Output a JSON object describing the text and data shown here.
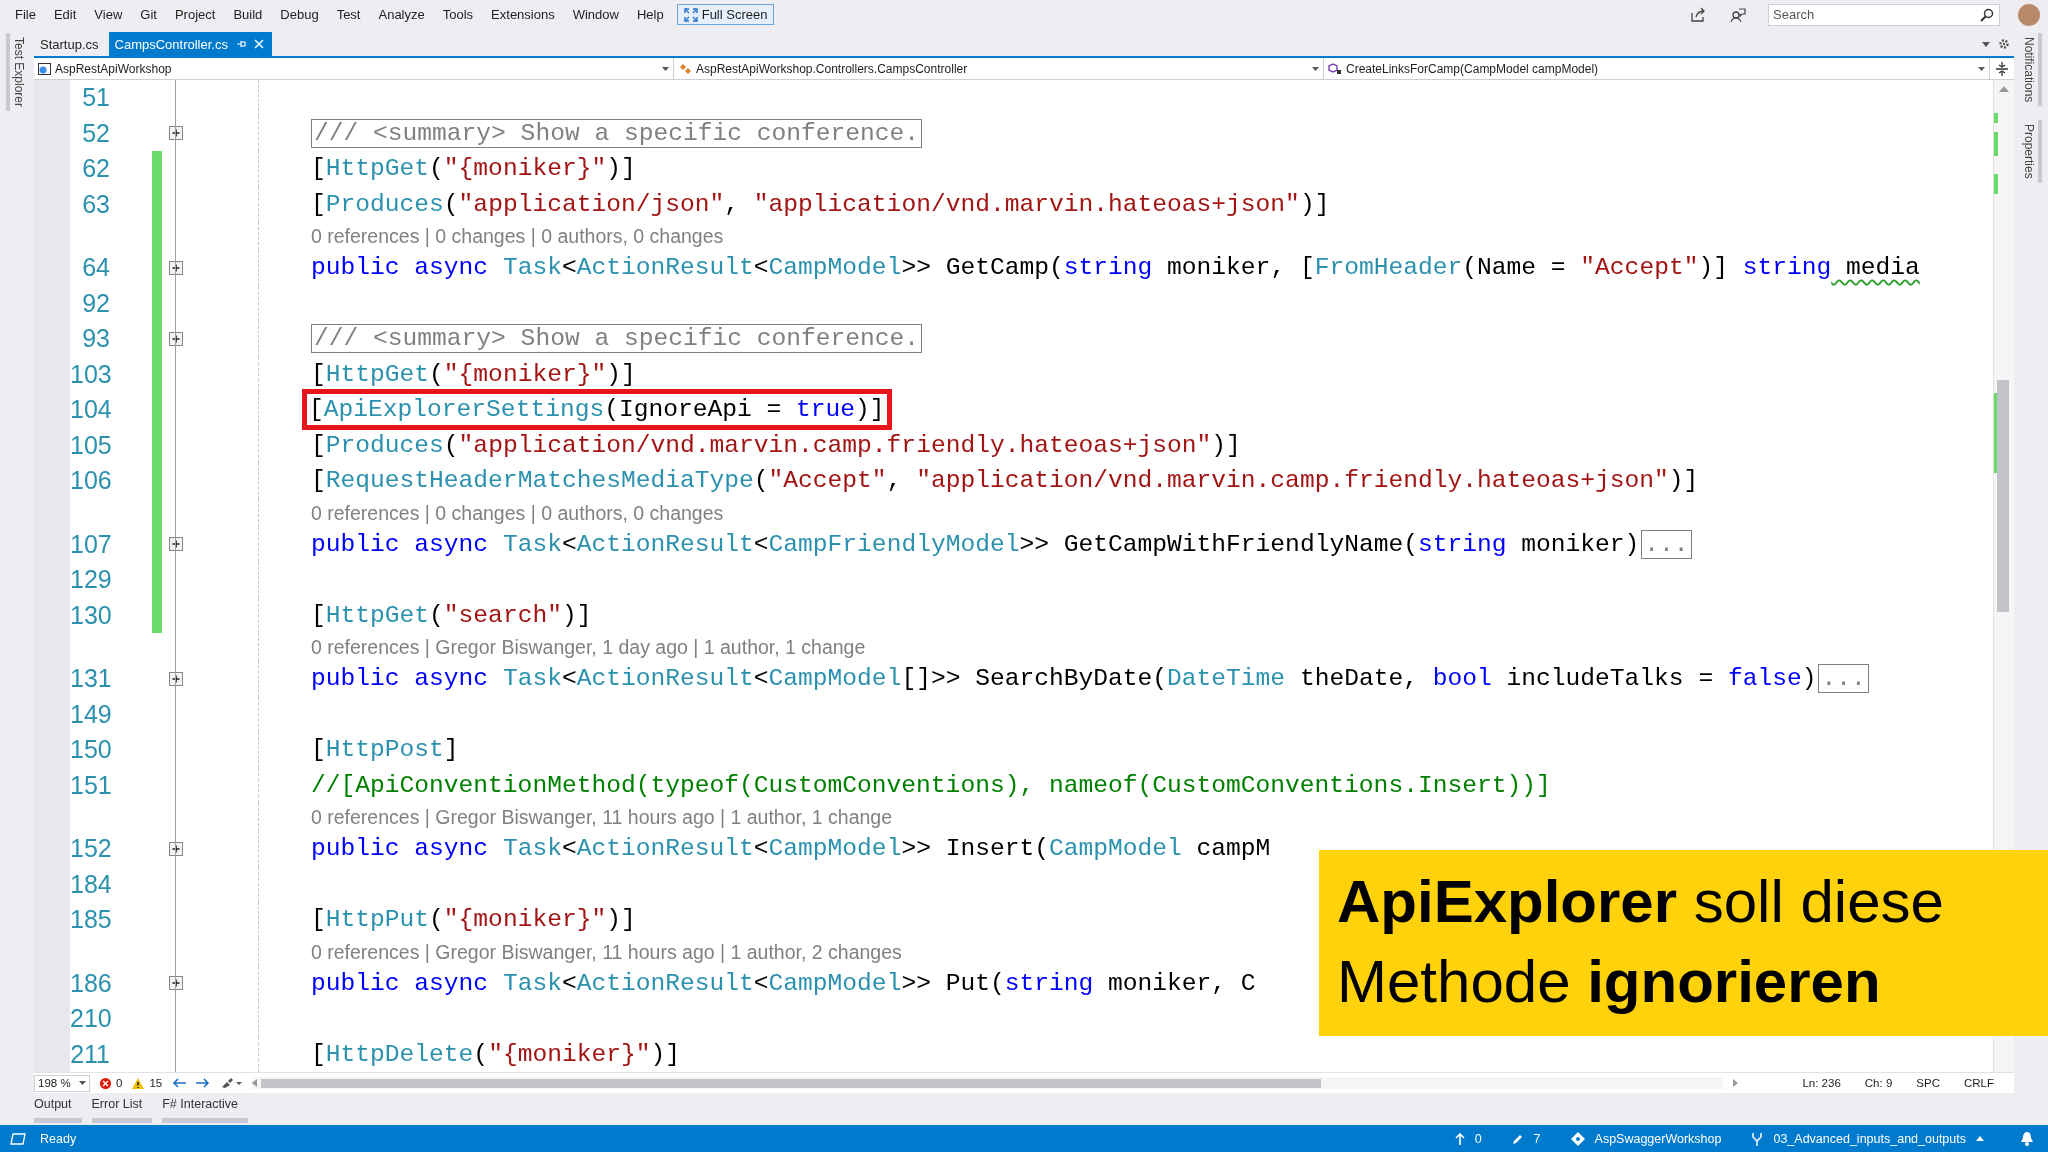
{
  "menu": [
    "File",
    "Edit",
    "View",
    "Git",
    "Project",
    "Build",
    "Debug",
    "Test",
    "Analyze",
    "Tools",
    "Extensions",
    "Window",
    "Help"
  ],
  "full_screen_button": "Full Screen",
  "search": {
    "placeholder": "Search"
  },
  "side_tabs_left": [
    "Test Explorer"
  ],
  "side_tabs_right": [
    "Notifications",
    "Properties"
  ],
  "document_tabs": [
    {
      "label": "Startup.cs",
      "selected": false
    },
    {
      "label": "CampsController.cs",
      "selected": true
    }
  ],
  "navigation": {
    "project": "AspRestApiWorkshop",
    "type": "AspRestApiWorkshop.Controllers.CampsController",
    "member": "CreateLinksForCamp(CampModel campModel)"
  },
  "editor": {
    "lines": [
      {
        "kind": "code",
        "number": "51",
        "changed": false,
        "collapsed": false,
        "highlighted": false
      },
      {
        "kind": "code",
        "number": "52",
        "changed": false,
        "collapsed": true,
        "highlighted": false,
        "tokens": [
          {
            "text": "/// <summary> Show a specific conference.",
            "kind": "summary"
          }
        ]
      },
      {
        "kind": "code",
        "number": "62",
        "changed": true,
        "collapsed": false,
        "highlighted": false,
        "tokens": [
          {
            "text": "[",
            "kind": "plain"
          },
          {
            "text": "HttpGet",
            "kind": "type"
          },
          {
            "text": "(",
            "kind": "plain"
          },
          {
            "text": "\"{moniker}\"",
            "kind": "string"
          },
          {
            "text": ")]",
            "kind": "plain"
          }
        ]
      },
      {
        "kind": "code",
        "number": "63",
        "changed": true,
        "collapsed": false,
        "highlighted": false,
        "tokens": [
          {
            "text": "[",
            "kind": "plain"
          },
          {
            "text": "Produces",
            "kind": "type"
          },
          {
            "text": "(",
            "kind": "plain"
          },
          {
            "text": "\"application/json\"",
            "kind": "string"
          },
          {
            "text": ", ",
            "kind": "plain"
          },
          {
            "text": "\"application/vnd.marvin.hateoas+json\"",
            "kind": "string"
          },
          {
            "text": ")]",
            "kind": "plain"
          }
        ]
      },
      {
        "kind": "lens",
        "text": "0 references | 0 changes | 0 authors, 0 changes",
        "changed": true
      },
      {
        "kind": "code",
        "number": "64",
        "changed": true,
        "collapsed": true,
        "highlighted": false,
        "tokens": [
          {
            "text": "public async ",
            "kind": "keyword"
          },
          {
            "text": "Task",
            "kind": "type"
          },
          {
            "text": "<",
            "kind": "plain"
          },
          {
            "text": "ActionResult",
            "kind": "type"
          },
          {
            "text": "<",
            "kind": "plain"
          },
          {
            "text": "CampModel",
            "kind": "type"
          },
          {
            "text": ">> GetCamp(",
            "kind": "plain"
          },
          {
            "text": "string",
            "kind": "keyword"
          },
          {
            "text": " moniker, [",
            "kind": "plain"
          },
          {
            "text": "FromHeader",
            "kind": "type"
          },
          {
            "text": "(Name = ",
            "kind": "plain"
          },
          {
            "text": "\"Accept\"",
            "kind": "string"
          },
          {
            "text": ")] ",
            "kind": "plain"
          },
          {
            "text": "string",
            "kind": "keyword"
          },
          {
            "text": " media",
            "kind": "plain",
            "warning": true
          }
        ]
      },
      {
        "kind": "code",
        "number": "92",
        "changed": true,
        "collapsed": false,
        "highlighted": false
      },
      {
        "kind": "code",
        "number": "93",
        "changed": true,
        "collapsed": true,
        "highlighted": false,
        "tokens": [
          {
            "text": "/// <summary> Show a specific conference.",
            "kind": "summary"
          }
        ]
      },
      {
        "kind": "code",
        "number": "103",
        "changed": true,
        "collapsed": false,
        "highlighted": false,
        "tokens": [
          {
            "text": "[",
            "kind": "plain"
          },
          {
            "text": "HttpGet",
            "kind": "type"
          },
          {
            "text": "(",
            "kind": "plain"
          },
          {
            "text": "\"{moniker}\"",
            "kind": "string"
          },
          {
            "text": ")]",
            "kind": "plain"
          }
        ]
      },
      {
        "kind": "code",
        "number": "104",
        "changed": true,
        "collapsed": false,
        "highlighted": true,
        "tokens": [
          {
            "text": "[",
            "kind": "plain"
          },
          {
            "text": "ApiExplorerSettings",
            "kind": "type"
          },
          {
            "text": "(IgnoreApi = ",
            "kind": "plain"
          },
          {
            "text": "true",
            "kind": "keyword"
          },
          {
            "text": ")]",
            "kind": "plain"
          }
        ]
      },
      {
        "kind": "code",
        "number": "105",
        "changed": true,
        "collapsed": false,
        "highlighted": false,
        "tokens": [
          {
            "text": "[",
            "kind": "plain"
          },
          {
            "text": "Produces",
            "kind": "type"
          },
          {
            "text": "(",
            "kind": "plain"
          },
          {
            "text": "\"application/vnd.marvin.camp.friendly.hateoas+json\"",
            "kind": "string"
          },
          {
            "text": ")]",
            "kind": "plain"
          }
        ]
      },
      {
        "kind": "code",
        "number": "106",
        "changed": true,
        "collapsed": false,
        "highlighted": false,
        "tokens": [
          {
            "text": "[",
            "kind": "plain"
          },
          {
            "text": "RequestHeaderMatchesMediaType",
            "kind": "type"
          },
          {
            "text": "(",
            "kind": "plain"
          },
          {
            "text": "\"Accept\"",
            "kind": "string"
          },
          {
            "text": ", ",
            "kind": "plain"
          },
          {
            "text": "\"application/vnd.marvin.camp.friendly.hateoas+json\"",
            "kind": "string"
          },
          {
            "text": ")]",
            "kind": "plain"
          }
        ]
      },
      {
        "kind": "lens",
        "text": "0 references | 0 changes | 0 authors, 0 changes",
        "changed": true
      },
      {
        "kind": "code",
        "number": "107",
        "changed": true,
        "collapsed": true,
        "highlighted": false,
        "tokens": [
          {
            "text": "public async ",
            "kind": "keyword"
          },
          {
            "text": "Task",
            "kind": "type"
          },
          {
            "text": "<",
            "kind": "plain"
          },
          {
            "text": "ActionResult",
            "kind": "type"
          },
          {
            "text": "<",
            "kind": "plain"
          },
          {
            "text": "CampFriendlyModel",
            "kind": "type"
          },
          {
            "text": ">> GetCampWithFriendlyName(",
            "kind": "plain"
          },
          {
            "text": "string",
            "kind": "keyword"
          },
          {
            "text": " moniker)",
            "kind": "plain"
          },
          {
            "text": "...",
            "kind": "collapsed"
          }
        ]
      },
      {
        "kind": "code",
        "number": "129",
        "changed": true,
        "collapsed": false,
        "highlighted": false
      },
      {
        "kind": "code",
        "number": "130",
        "changed": true,
        "collapsed": false,
        "highlighted": false,
        "tokens": [
          {
            "text": "[",
            "kind": "plain"
          },
          {
            "text": "HttpGet",
            "kind": "type"
          },
          {
            "text": "(",
            "kind": "plain"
          },
          {
            "text": "\"search\"",
            "kind": "string"
          },
          {
            "text": ")]",
            "kind": "plain"
          }
        ]
      },
      {
        "kind": "lens",
        "text": "0 references | Gregor Biswanger, 1 day ago | 1 author, 1 change",
        "changed": false
      },
      {
        "kind": "code",
        "number": "131",
        "changed": false,
        "collapsed": true,
        "highlighted": false,
        "tokens": [
          {
            "text": "public async ",
            "kind": "keyword"
          },
          {
            "text": "Task",
            "kind": "type"
          },
          {
            "text": "<",
            "kind": "plain"
          },
          {
            "text": "ActionResult",
            "kind": "type"
          },
          {
            "text": "<",
            "kind": "plain"
          },
          {
            "text": "CampModel",
            "kind": "type"
          },
          {
            "text": "[]>> SearchByDate(",
            "kind": "plain"
          },
          {
            "text": "DateTime",
            "kind": "type"
          },
          {
            "text": " theDate, ",
            "kind": "plain"
          },
          {
            "text": "bool",
            "kind": "keyword"
          },
          {
            "text": " includeTalks = ",
            "kind": "plain"
          },
          {
            "text": "false",
            "kind": "keyword"
          },
          {
            "text": ")",
            "kind": "plain"
          },
          {
            "text": "...",
            "kind": "collapsed"
          }
        ]
      },
      {
        "kind": "code",
        "number": "149",
        "changed": false,
        "collapsed": false,
        "highlighted": false
      },
      {
        "kind": "code",
        "number": "150",
        "changed": false,
        "collapsed": false,
        "highlighted": false,
        "tokens": [
          {
            "text": "[",
            "kind": "plain"
          },
          {
            "text": "HttpPost",
            "kind": "type"
          },
          {
            "text": "]",
            "kind": "plain"
          }
        ]
      },
      {
        "kind": "code",
        "number": "151",
        "changed": false,
        "collapsed": false,
        "highlighted": false,
        "tokens": [
          {
            "text": "//[ApiConventionMethod(typeof(CustomConventions), nameof(CustomConventions.Insert))]",
            "kind": "comment"
          }
        ]
      },
      {
        "kind": "lens",
        "text": "0 references | Gregor Biswanger, 11 hours ago | 1 author, 1 change",
        "changed": false
      },
      {
        "kind": "code",
        "number": "152",
        "changed": false,
        "collapsed": true,
        "highlighted": false,
        "tokens": [
          {
            "text": "public async ",
            "kind": "keyword"
          },
          {
            "text": "Task",
            "kind": "type"
          },
          {
            "text": "<",
            "kind": "plain"
          },
          {
            "text": "ActionResult",
            "kind": "type"
          },
          {
            "text": "<",
            "kind": "plain"
          },
          {
            "text": "CampModel",
            "kind": "type"
          },
          {
            "text": ">> Insert(",
            "kind": "plain"
          },
          {
            "text": "CampModel",
            "kind": "type"
          },
          {
            "text": " campM",
            "kind": "plain"
          }
        ]
      },
      {
        "kind": "code",
        "number": "184",
        "changed": false,
        "collapsed": false,
        "highlighted": false
      },
      {
        "kind": "code",
        "number": "185",
        "changed": false,
        "collapsed": false,
        "highlighted": false,
        "tokens": [
          {
            "text": "[",
            "kind": "plain"
          },
          {
            "text": "HttpPut",
            "kind": "type"
          },
          {
            "text": "(",
            "kind": "plain"
          },
          {
            "text": "\"{moniker}\"",
            "kind": "string"
          },
          {
            "text": ")]",
            "kind": "plain"
          }
        ]
      },
      {
        "kind": "lens",
        "text": "0 references | Gregor Biswanger, 11 hours ago | 1 author, 2 changes",
        "changed": false
      },
      {
        "kind": "code",
        "number": "186",
        "changed": false,
        "collapsed": true,
        "highlighted": false,
        "tokens": [
          {
            "text": "public async ",
            "kind": "keyword"
          },
          {
            "text": "Task",
            "kind": "type"
          },
          {
            "text": "<",
            "kind": "plain"
          },
          {
            "text": "ActionResult",
            "kind": "type"
          },
          {
            "text": "<",
            "kind": "plain"
          },
          {
            "text": "CampModel",
            "kind": "type"
          },
          {
            "text": ">> Put(",
            "kind": "plain"
          },
          {
            "text": "string",
            "kind": "keyword"
          },
          {
            "text": " moniker, C",
            "kind": "plain"
          }
        ]
      },
      {
        "kind": "code",
        "number": "210",
        "changed": false,
        "collapsed": false,
        "highlighted": false
      },
      {
        "kind": "code",
        "number": "211",
        "changed": false,
        "collapsed": false,
        "highlighted": false,
        "tokens": [
          {
            "text": "[",
            "kind": "plain"
          },
          {
            "text": "HttpDelete",
            "kind": "type"
          },
          {
            "text": "(",
            "kind": "plain"
          },
          {
            "text": "\"{moniker}\"",
            "kind": "string"
          },
          {
            "text": ")]",
            "kind": "plain"
          }
        ]
      }
    ]
  },
  "editor_footer": {
    "zoom": "198 %",
    "errors": "0",
    "warnings": "15",
    "line": "Ln: 236",
    "column": "Ch: 9",
    "spacing": "SPC",
    "line_ending": "CRLF"
  },
  "tool_tabs": [
    "Output",
    "Error List",
    "F# Interactive"
  ],
  "status_bar": {
    "state": "Ready",
    "pushes": "0",
    "edits": "7",
    "repository": "AspSwaggerWorkshop",
    "branch": "03_Advanced_inputs_and_outputs"
  },
  "caption": "**ApiExplorer** soll diese Methode **ignorieren**"
}
